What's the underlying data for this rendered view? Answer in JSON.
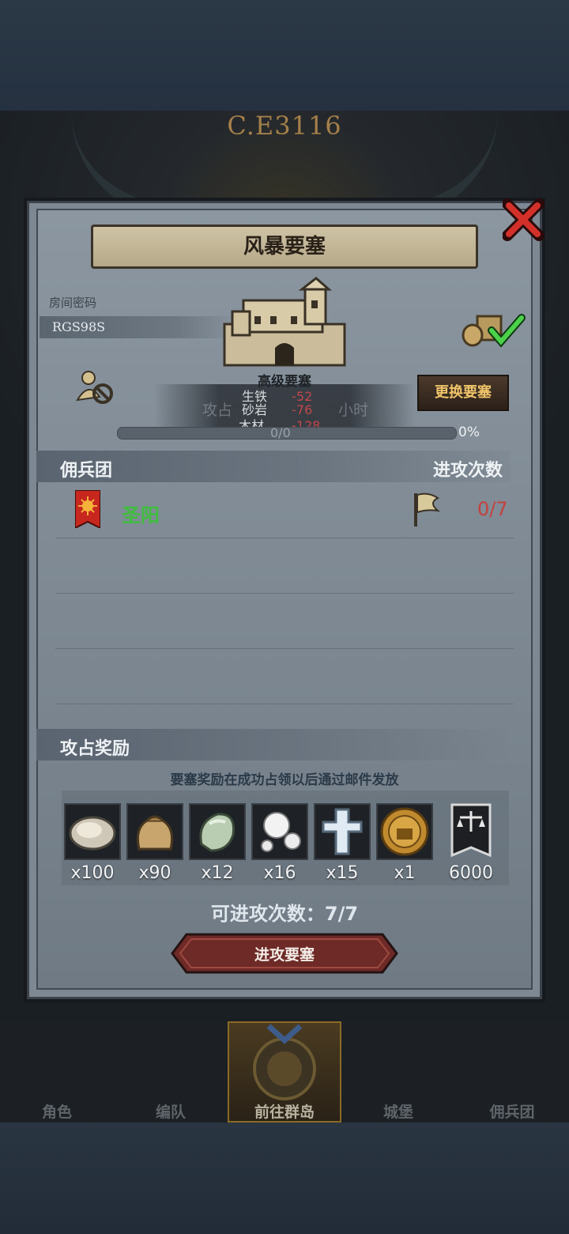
{
  "background": {
    "era_text": "C.E3116"
  },
  "dialog": {
    "title": "风暴要塞",
    "room_label": "房间密码",
    "room_code": "RGS98S",
    "fortress_level": "高级要塞",
    "change_button": "更换要塞",
    "resources": [
      {
        "name": "生铁",
        "value": "-52"
      },
      {
        "name": "砂岩",
        "value": "-76"
      },
      {
        "name": "木材",
        "value": "-128"
      }
    ],
    "ghost_text": "攻占",
    "ghost_time": "小时",
    "progress_text": "0/0",
    "progress_percent": "0%"
  },
  "mercenary": {
    "header_left": "佣兵团",
    "header_right": "进攻次数",
    "rows": [
      {
        "name": "圣阳",
        "count": "0/7"
      }
    ]
  },
  "rewards": {
    "header": "攻占奖励",
    "note": "要塞奖励在成功占领以后通过邮件发放",
    "items": [
      {
        "icon": "oyster-icon",
        "qty": "x100"
      },
      {
        "icon": "sack-icon",
        "qty": "x90"
      },
      {
        "icon": "jade-stone-icon",
        "qty": "x12"
      },
      {
        "icon": "pearls-icon",
        "qty": "x16"
      },
      {
        "icon": "crystal-cross-icon",
        "qty": "x15"
      },
      {
        "icon": "knight-coin-icon",
        "qty": "x1"
      },
      {
        "icon": "justice-banner-icon",
        "qty": "6000"
      }
    ],
    "attempts": "可进攻次数：7/7",
    "attack_button": "进攻要塞"
  },
  "nav": {
    "items": [
      {
        "label": "角色"
      },
      {
        "label": "编队"
      },
      {
        "label": "前往群岛"
      },
      {
        "label": "城堡"
      },
      {
        "label": "佣兵团"
      }
    ],
    "active_index": 2
  },
  "colors": {
    "green_name": "#3fbd3e",
    "red_count": "#c4413f",
    "gold_button_text": "#f0c46a"
  }
}
